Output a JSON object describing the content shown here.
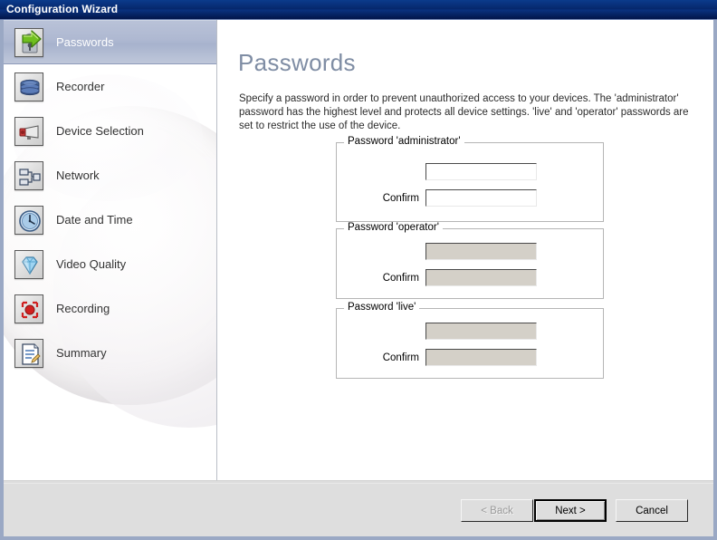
{
  "window": {
    "title": "Configuration Wizard"
  },
  "sidebar": {
    "items": [
      {
        "label": "Passwords",
        "icon": "padlock-arrow-icon",
        "selected": true
      },
      {
        "label": "Recorder",
        "icon": "database-icon",
        "selected": false
      },
      {
        "label": "Device Selection",
        "icon": "camera-icon",
        "selected": false
      },
      {
        "label": "Network",
        "icon": "network-nodes-icon",
        "selected": false
      },
      {
        "label": "Date and Time",
        "icon": "clock-icon",
        "selected": false
      },
      {
        "label": "Video Quality",
        "icon": "diamond-icon",
        "selected": false
      },
      {
        "label": "Recording",
        "icon": "record-dot-icon",
        "selected": false
      },
      {
        "label": "Summary",
        "icon": "document-list-icon",
        "selected": false
      }
    ]
  },
  "main": {
    "title": "Passwords",
    "description": "Specify a password in order to prevent unauthorized access to your devices. The 'administrator' password has the highest level and protects all device settings. 'live' and 'operator' passwords are set to restrict the use of the device.",
    "groups": [
      {
        "legend": "Password 'administrator'",
        "password_value": "",
        "confirm_label": "Confirm",
        "confirm_value": "",
        "enabled": true
      },
      {
        "legend": "Password 'operator'",
        "password_value": "",
        "confirm_label": "Confirm",
        "confirm_value": "",
        "enabled": false
      },
      {
        "legend": "Password 'live'",
        "password_value": "",
        "confirm_label": "Confirm",
        "confirm_value": "",
        "enabled": false
      }
    ]
  },
  "footer": {
    "back_label": "< Back",
    "next_label": "Next >",
    "cancel_label": "Cancel"
  },
  "colors": {
    "titlebar_start": "#0b3b8c",
    "titlebar_end": "#02154a",
    "frame_border": "#9aa8c4",
    "selected_item_bg": "#b0bad3",
    "page_title": "#7f8da4",
    "footer_bg": "#dedede",
    "disabled_field_bg": "#d4d0c8"
  }
}
